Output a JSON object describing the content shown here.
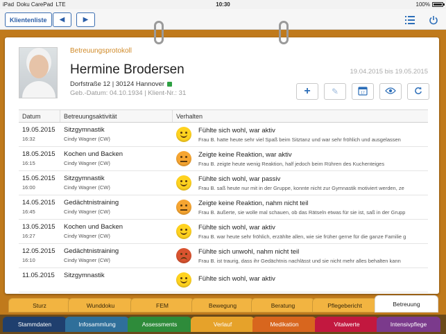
{
  "status": {
    "carrier": "iPad",
    "app": "Doku CarePad",
    "network": "LTE",
    "time": "10:30",
    "battery": "100%"
  },
  "toolbar": {
    "client_list": "Klientenliste"
  },
  "header": {
    "protocol_title": "Betreuungsprotokoll",
    "name": "Hermine Brodersen",
    "address": "Dorfstraße 12 | 30124 Hannover",
    "meta": "Geb.-Datum: 04.10.1934 | Klient-Nr.: 31",
    "daterange": "19.04.2015 bis 19.05.2015"
  },
  "table": {
    "headers": [
      "Datum",
      "Betreuungsaktivität",
      "Verhalten"
    ],
    "rows": [
      {
        "date": "19.05.2015",
        "time": "16:32",
        "activity": "Sitzgymnastik",
        "staff": "Cindy Wagner (CW)",
        "mood": "happy",
        "behavior": "Fühlte sich wohl, war aktiv",
        "note": "Frau B. hatte heute sehr viel Spaß beim Sitztanz und war sehr fröhlich und ausgelassen"
      },
      {
        "date": "18.05.2015",
        "time": "16:15",
        "activity": "Kochen und Backen",
        "staff": "Cindy Wagner (CW)",
        "mood": "neutral",
        "behavior": "Zeigte keine Reaktion, war aktiv",
        "note": "Frau B. zeigte heute wenig Reaktion, half jedoch beim Rühren des Kuchenteiges"
      },
      {
        "date": "15.05.2015",
        "time": "16:00",
        "activity": "Sitzgymnastik",
        "staff": "Cindy Wagner (CW)",
        "mood": "happy",
        "behavior": "Fühlte sich wohl, war passiv",
        "note": "Frau B. saß heute nur mit in der Gruppe, konnte nicht zur Gymnastik motiviert werden, ze"
      },
      {
        "date": "14.05.2015",
        "time": "16:45",
        "activity": "Gedächtnistraining",
        "staff": "Cindy Wagner (CW)",
        "mood": "neutral",
        "behavior": "Zeigte keine Reaktion, nahm nicht teil",
        "note": "Frau B. äußerte, sie wolle mal schauen, ob das Rätseln etwas für sie ist, saß in der Grupp"
      },
      {
        "date": "13.05.2015",
        "time": "16:27",
        "activity": "Kochen und Backen",
        "staff": "Cindy Wagner (CW)",
        "mood": "happy",
        "behavior": "Fühlte sich wohl, war aktiv",
        "note": "Frau B. war heute sehr fröhlich, erzählte allen, wie sie früher gerne für die ganze Familie g"
      },
      {
        "date": "12.05.2015",
        "time": "16:10",
        "activity": "Gedächtnistraining",
        "staff": "Cindy Wagner (CW)",
        "mood": "sad",
        "behavior": "Fühlte sich unwohl, nahm nicht teil",
        "note": "Frau B. ist traurig, dass ihr Gedächtnis nachlässt und sie nicht mehr alles behalten kann"
      },
      {
        "date": "11.05.2015",
        "time": "",
        "activity": "Sitzgymnastik",
        "staff": "",
        "mood": "happy",
        "behavior": "Fühlte sich wohl, war aktiv",
        "note": ""
      }
    ]
  },
  "tabs_top": [
    "Sturz",
    "Wunddoku",
    "FEM",
    "Bewegung",
    "Beratung",
    "Pflegebericht",
    "Betreuung"
  ],
  "tabs_bottom": [
    {
      "label": "Stammdaten",
      "color": "#1f3f6e"
    },
    {
      "label": "Infosammlung",
      "color": "#2f6f9a"
    },
    {
      "label": "Assessments",
      "color": "#2e8b3a"
    },
    {
      "label": "Verlauf",
      "color": "#e6a22a"
    },
    {
      "label": "Medikation",
      "color": "#d8661e"
    },
    {
      "label": "Vitalwerte",
      "color": "#c2183f"
    },
    {
      "label": "Intensivpflege",
      "color": "#7b3a8c"
    }
  ]
}
